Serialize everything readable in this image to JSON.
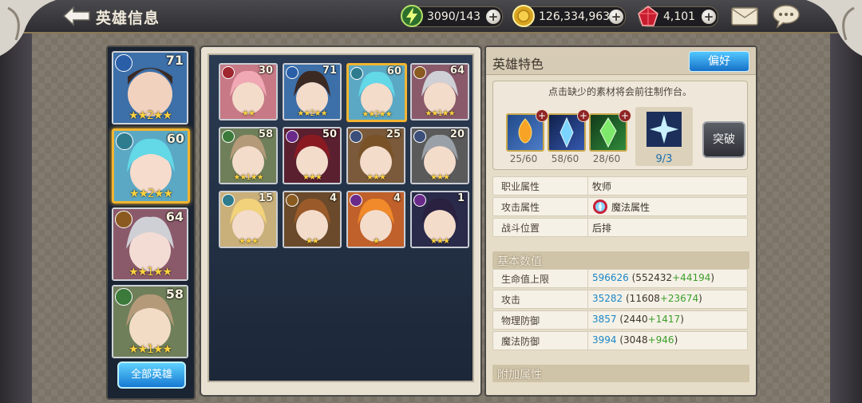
{
  "header": {
    "title": "英雄信息",
    "stamina": "3090/143",
    "gold": "126,334,963",
    "gems": "4,101"
  },
  "colors": {
    "accent": "#f2b530",
    "button_blue": "#1b86c6",
    "bonus_green": "#3c9e2c"
  },
  "left_list": {
    "heroes": [
      {
        "class": "archer",
        "level": "71",
        "stars": "★★2★★"
      },
      {
        "class": "priest",
        "level": "60",
        "stars": "★★2★★",
        "selected": true
      },
      {
        "class": "warrior",
        "level": "64",
        "stars": "★★1★★"
      },
      {
        "class": "support",
        "level": "58",
        "stars": "★★1★★"
      }
    ],
    "all_heroes_label": "全部英雄"
  },
  "grid": {
    "heroes": [
      {
        "class": "hammer",
        "level": "30",
        "stars": "★★"
      },
      {
        "class": "archer",
        "level": "71",
        "stars": "★★2★★"
      },
      {
        "class": "priest",
        "level": "60",
        "stars": "★★2★★",
        "selected": true
      },
      {
        "class": "warrior",
        "level": "64",
        "stars": "★★1★★"
      },
      {
        "class": "support",
        "level": "58",
        "stars": "★★1★★"
      },
      {
        "class": "assassin",
        "level": "50",
        "stars": "★★★"
      },
      {
        "class": "tank",
        "level": "25",
        "stars": "★★★"
      },
      {
        "class": "tank",
        "level": "20",
        "stars": "★★★"
      },
      {
        "class": "priest",
        "level": "15",
        "stars": "★★★"
      },
      {
        "class": "warrior",
        "level": "4",
        "stars": "★★"
      },
      {
        "class": "assassin",
        "level": "4",
        "stars": "★"
      },
      {
        "class": "assassin",
        "level": "1",
        "stars": "★★★"
      }
    ]
  },
  "detail": {
    "title": "英雄特色",
    "pref_button": "偏好",
    "craft_hint": "点击缺少的素材将会前往制作台。",
    "materials": [
      {
        "name": "fire-crystal",
        "count": "25/60"
      },
      {
        "name": "ice-crystal",
        "count": "58/60"
      },
      {
        "name": "nature-crystal",
        "count": "28/60"
      }
    ],
    "soulstone_count": "9/3",
    "break_button": "突破",
    "attributes": [
      {
        "key": "职业属性",
        "value": "牧师"
      },
      {
        "key": "攻击属性",
        "value": "魔法属性"
      },
      {
        "key": "战斗位置",
        "value": "后排"
      }
    ],
    "base_stats_title": "基本数值",
    "stats": [
      {
        "key": "生命值上限",
        "total": "596626",
        "base": " (552432",
        "bonus": "+44194",
        "close": ")"
      },
      {
        "key": "攻击",
        "total": "35282",
        "base": " (11608",
        "bonus": "+23674",
        "close": ")"
      },
      {
        "key": "物理防御",
        "total": "3857",
        "base": " (2440",
        "bonus": "+1417",
        "close": ")"
      },
      {
        "key": "魔法防御",
        "total": "3994",
        "base": " (3048",
        "bonus": "+946",
        "close": ")"
      }
    ],
    "extra_title": "附加属性"
  }
}
